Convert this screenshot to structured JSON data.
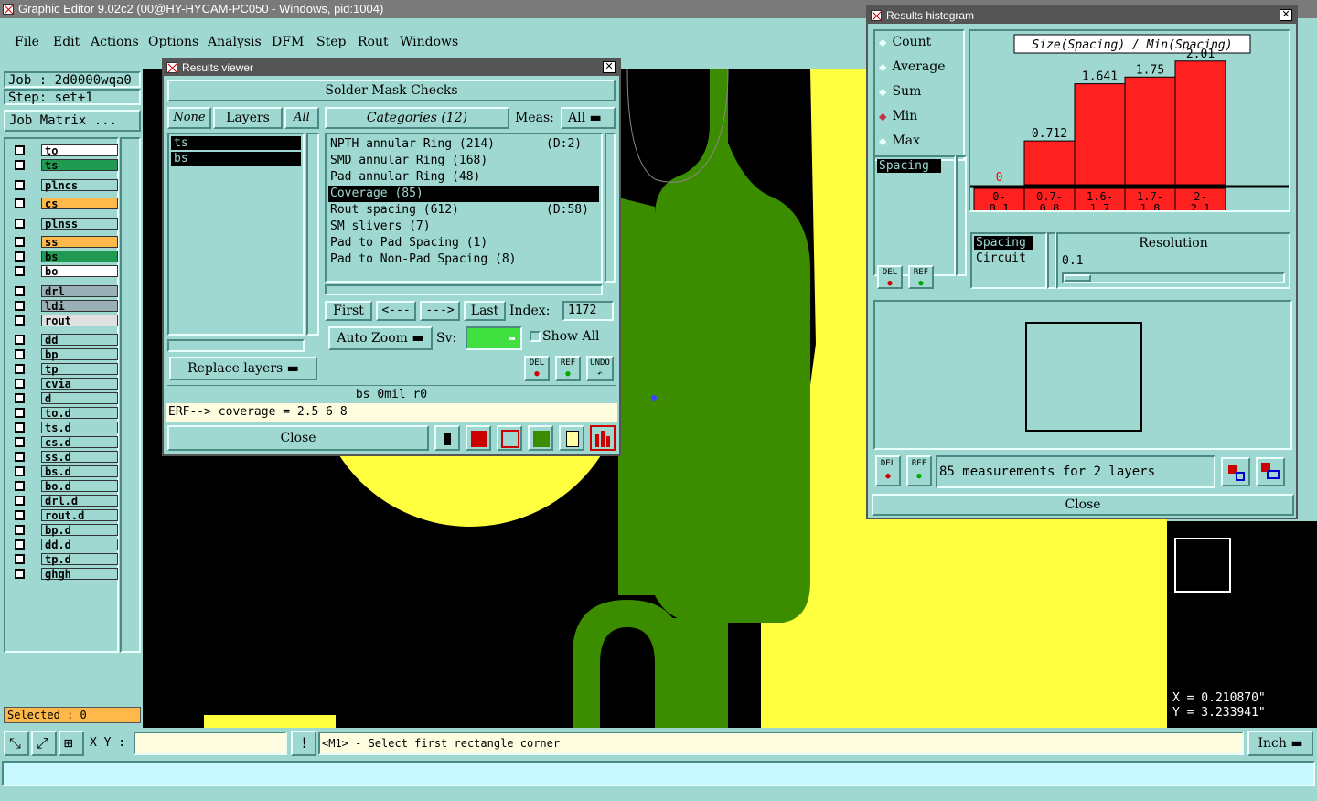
{
  "app": {
    "title": "Graphic Editor 9.02c2 (00@HY-HYCAM-PC050 - Windows, pid:1004)"
  },
  "menu": [
    "File",
    "Edit",
    "Actions",
    "Options",
    "Analysis",
    "DFM",
    "Step",
    "Rout",
    "Windows"
  ],
  "left_panel": {
    "job": "Job : 2d0000wqa0",
    "step": "Step: set+1",
    "job_matrix": "Job Matrix ...",
    "selected": "Selected : 0",
    "layers": [
      {
        "name": "to",
        "color": "#ffffff"
      },
      {
        "name": "ts",
        "color": "#1f9a50"
      },
      {
        "name": "plncs",
        "color": "#9ed8d0"
      },
      {
        "name": "cs",
        "color": "#ffb84a"
      },
      {
        "name": "plnss",
        "color": "#9ed8d0"
      },
      {
        "name": "ss",
        "color": "#ffb84a"
      },
      {
        "name": "bs",
        "color": "#1f9a50"
      },
      {
        "name": "bo",
        "color": "#ffffff"
      },
      {
        "name": "drl",
        "color": "#9ab0b6"
      },
      {
        "name": "ldi",
        "color": "#9ab0b6"
      },
      {
        "name": "rout",
        "color": "#e0e0e0"
      },
      {
        "name": "dd",
        "color": "#9ed8d0"
      },
      {
        "name": "bp",
        "color": "#9ed8d0"
      },
      {
        "name": "tp",
        "color": "#9ed8d0"
      },
      {
        "name": "cvia",
        "color": "#9ed8d0"
      },
      {
        "name": "d",
        "color": "#9ed8d0"
      },
      {
        "name": "to.d",
        "color": "#9ed8d0"
      },
      {
        "name": "ts.d",
        "color": "#9ed8d0"
      },
      {
        "name": "cs.d",
        "color": "#9ed8d0"
      },
      {
        "name": "ss.d",
        "color": "#9ed8d0"
      },
      {
        "name": "bs.d",
        "color": "#9ed8d0"
      },
      {
        "name": "bo.d",
        "color": "#9ed8d0"
      },
      {
        "name": "drl.d",
        "color": "#9ed8d0"
      },
      {
        "name": "rout.d",
        "color": "#9ed8d0"
      },
      {
        "name": "bp.d",
        "color": "#9ed8d0"
      },
      {
        "name": "dd.d",
        "color": "#9ed8d0"
      },
      {
        "name": "tp.d",
        "color": "#9ed8d0"
      },
      {
        "name": "ghgh",
        "color": "#9ed8d0"
      }
    ]
  },
  "results_viewer": {
    "title": "Results viewer",
    "header": "Solder Mask Checks",
    "none_btn": "None",
    "layers_btn": "Layers",
    "all_btn": "All",
    "categories_btn": "Categories (12)",
    "meas_label": "Meas:",
    "meas_value": "All",
    "layer_list": [
      "ts",
      "bs"
    ],
    "categories": [
      {
        "name": "NPTH annular Ring (214)",
        "extra": "(D:2)"
      },
      {
        "name": "SMD annular Ring (168)",
        "extra": ""
      },
      {
        "name": "Pad annular Ring (48)",
        "extra": ""
      },
      {
        "name": "Coverage (85)",
        "extra": ""
      },
      {
        "name": "Rout spacing (612)",
        "extra": "(D:58)"
      },
      {
        "name": "SM slivers (7)",
        "extra": ""
      },
      {
        "name": "Pad to Pad Spacing (1)",
        "extra": ""
      },
      {
        "name": "Pad to Non-Pad Spacing (8)",
        "extra": ""
      }
    ],
    "first": "First",
    "prev": "<---",
    "next": "--->",
    "last": "Last",
    "index_label": "Index:",
    "index_value": "1172",
    "auto_zoom": "Auto Zoom",
    "sv_label": "Sv:",
    "show_all": "Show All",
    "replace_layers": "Replace layers",
    "del": "DEL",
    "ref": "REF",
    "undo": "UNDO",
    "status": "bs 0mil  r0",
    "erf": "ERF--> coverage = 2.5 6 8",
    "close": "Close"
  },
  "results_histogram": {
    "title": "Results histogram",
    "options": [
      "Count",
      "Average",
      "Sum",
      "Min",
      "Max"
    ],
    "selected_option": "Min",
    "chart_title": "Size(Spacing) / Min(Spacing)",
    "list1": [
      "Spacing"
    ],
    "list2": [
      "Spacing",
      "Circuit"
    ],
    "resolution_label": "Resolution",
    "resolution_value": "0.1",
    "summary": "85 measurements for 2 layers",
    "del": "DEL",
    "ref": "REF",
    "close": "Close"
  },
  "chart_data": {
    "type": "bar",
    "title": "Size(Spacing) / Min(Spacing)",
    "categories": [
      "0-\n0.1",
      "0.7-\n0.8",
      "1.6-\n1.7",
      "1.7-\n1.8",
      "2-\n2.1"
    ],
    "values": [
      0,
      0.712,
      1.641,
      1.75,
      2.01
    ],
    "value_labels": [
      "0",
      "0.712",
      "1.641",
      "1.75",
      "2.01"
    ],
    "ylim": [
      0,
      2.2
    ],
    "bar_color": "#ff2020",
    "zero_label_color": "#ff0000"
  },
  "coords": {
    "x": "X = 0.210870\"",
    "y": "Y = 3.233941\""
  },
  "bottom_bar": {
    "xy_label": "X Y :",
    "prompt": "<M1> - Select first rectangle corner",
    "units": "Inch"
  },
  "colors": {
    "panel": "#9ed8d0",
    "green_trace": "#3c8c00",
    "yellow": "#ffff40",
    "orange": "#c87840",
    "red": "#ff2020"
  }
}
